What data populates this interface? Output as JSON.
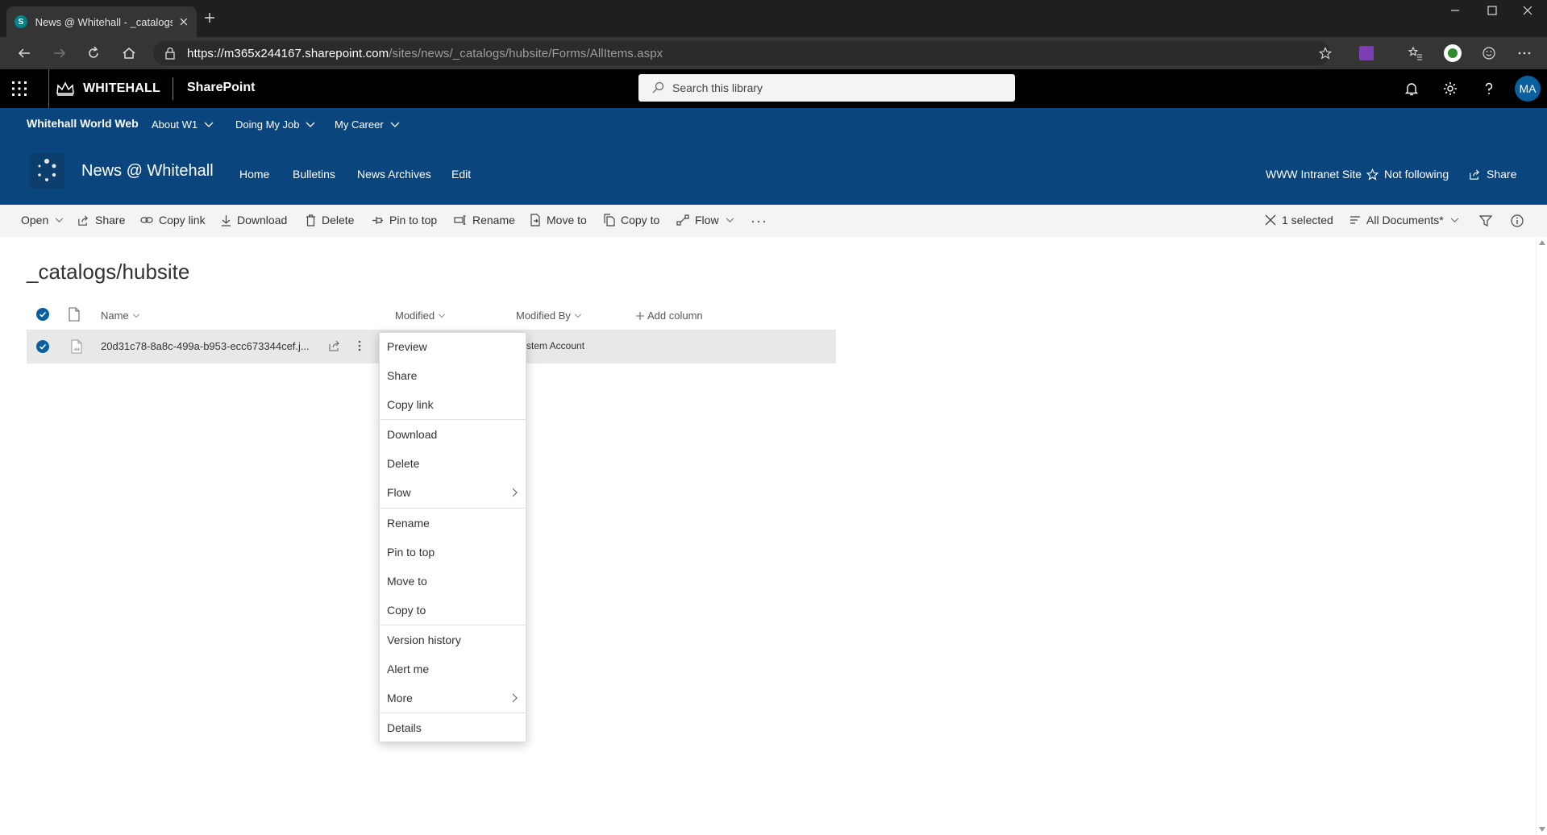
{
  "browser": {
    "tab_title": "News @ Whitehall - _catalogs/hubsite",
    "tab_favicon_text": "S",
    "url_host": "https://m365x244167.sharepoint.com",
    "url_path": "/sites/news/_catalogs/hubsite/Forms/AllItems.aspx"
  },
  "suite": {
    "brand": "WHITEHALL",
    "app": "SharePoint",
    "search_placeholder": "Search this library",
    "avatar_initials": "MA"
  },
  "hub": {
    "title": "Whitehall World Web",
    "items": [
      {
        "label": "About W1"
      },
      {
        "label": "Doing My Job"
      },
      {
        "label": "My Career"
      }
    ]
  },
  "site": {
    "title": "News @ Whitehall",
    "nav": [
      {
        "label": "Home"
      },
      {
        "label": "Bulletins"
      },
      {
        "label": "News Archives"
      },
      {
        "label": "Edit"
      }
    ],
    "hub_link": "WWW Intranet Site",
    "follow": "Not following",
    "share": "Share"
  },
  "commands": {
    "open": "Open",
    "share": "Share",
    "copy_link": "Copy link",
    "download": "Download",
    "delete": "Delete",
    "pin": "Pin to top",
    "rename": "Rename",
    "move": "Move to",
    "copy": "Copy to",
    "flow": "Flow",
    "selected": "1 selected",
    "view": "All Documents*"
  },
  "library": {
    "title": "_catalogs/hubsite",
    "columns": {
      "name": "Name",
      "modified": "Modified",
      "modified_by": "Modified By",
      "add": "Add column"
    },
    "rows": [
      {
        "name": "20d31c78-8a8c-499a-b953-ecc673344cef.j...",
        "modified_by": "stem Account"
      }
    ]
  },
  "context_menu": {
    "items": [
      {
        "label": "Preview"
      },
      {
        "label": "Share"
      },
      {
        "label": "Copy link"
      },
      {
        "label": "Download"
      },
      {
        "label": "Delete"
      },
      {
        "label": "Flow"
      },
      {
        "label": "Rename"
      },
      {
        "label": "Pin to top"
      },
      {
        "label": "Move to"
      },
      {
        "label": "Copy to"
      },
      {
        "label": "Version history"
      },
      {
        "label": "Alert me"
      },
      {
        "label": "More"
      },
      {
        "label": "Details"
      }
    ]
  },
  "colors": {
    "suite_bar": "#000000",
    "hub_nav": "#0a467d",
    "accent": "#0a5f9f"
  }
}
